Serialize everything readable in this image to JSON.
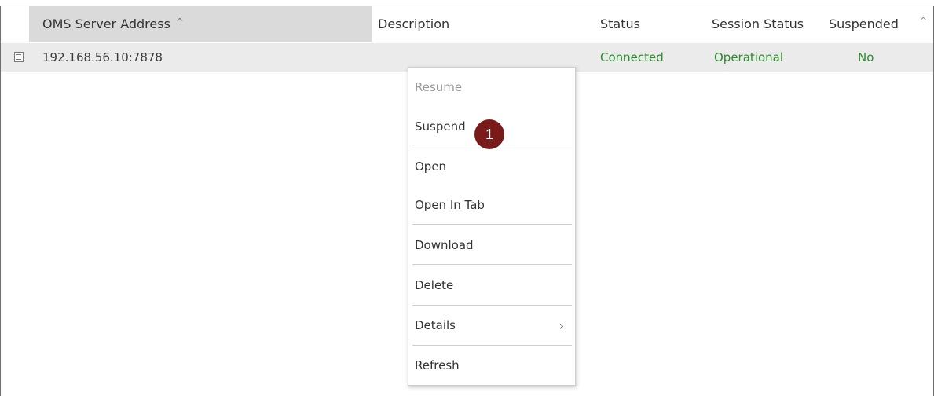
{
  "table": {
    "headers": {
      "oms_server_address": "OMS Server Address",
      "description": "Description",
      "status": "Status",
      "session_status": "Session Status",
      "suspended": "Suspended"
    },
    "rows": [
      {
        "oms_server_address": "192.168.56.10:7878",
        "description": "",
        "status": "Connected",
        "session_status": "Operational",
        "suspended": "No"
      }
    ]
  },
  "context_menu": {
    "items": [
      {
        "label": "Resume",
        "enabled": false
      },
      {
        "label": "Suspend",
        "enabled": true
      },
      {
        "label": "Open",
        "enabled": true
      },
      {
        "label": "Open In Tab",
        "enabled": true
      },
      {
        "label": "Download",
        "enabled": true
      },
      {
        "label": "Delete",
        "enabled": true
      },
      {
        "label": "Details",
        "enabled": true,
        "has_submenu": true
      },
      {
        "label": "Refresh",
        "enabled": true
      }
    ]
  },
  "callout": {
    "number": "1"
  },
  "colors": {
    "status_green": "#2e8b2e",
    "selected_row": "#ebebeb",
    "sorted_header": "#dadada",
    "callout": "#7a1b1b"
  },
  "icons": [
    "sort-caret-up-icon",
    "row-detail-icon",
    "scroll-up-icon",
    "chevron-right-icon"
  ]
}
